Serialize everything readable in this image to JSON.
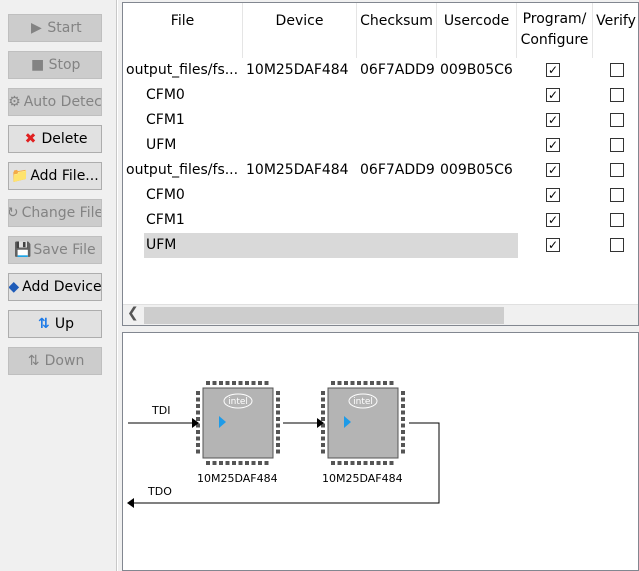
{
  "toolbar": {
    "buttons": [
      {
        "label": "Start",
        "icon": "start-icon",
        "enabled": false
      },
      {
        "label": "Stop",
        "icon": "stop-icon",
        "enabled": false
      },
      {
        "label": "Auto Detec",
        "icon": "auto-detect-icon",
        "enabled": false
      },
      {
        "label": "Delete",
        "icon": "delete-icon",
        "enabled": true
      },
      {
        "label": "Add File...",
        "icon": "add-file-icon",
        "enabled": true
      },
      {
        "label": "Change File",
        "icon": "change-file-icon",
        "enabled": false
      },
      {
        "label": "Save File",
        "icon": "save-file-icon",
        "enabled": false
      },
      {
        "label": "Add Device",
        "icon": "add-device-icon",
        "enabled": true
      },
      {
        "label": "Up",
        "icon": "up-icon",
        "enabled": true
      },
      {
        "label": "Down",
        "icon": "down-icon",
        "enabled": false
      }
    ]
  },
  "table": {
    "headers": [
      "File",
      "Device",
      "Checksum",
      "Usercode",
      "Program/ Configure",
      "Verify"
    ],
    "rows": [
      {
        "file": "output_files/fs...",
        "device": "10M25DAF484",
        "checksum": "06F7ADD9",
        "usercode": "009B05C6",
        "program": true,
        "verify": false
      },
      {
        "file": "CFM0",
        "device": "",
        "checksum": "",
        "usercode": "",
        "program": true,
        "verify": false
      },
      {
        "file": "CFM1",
        "device": "",
        "checksum": "",
        "usercode": "",
        "program": true,
        "verify": false
      },
      {
        "file": "UFM",
        "device": "",
        "checksum": "",
        "usercode": "",
        "program": true,
        "verify": false
      },
      {
        "file": "output_files/fs...",
        "device": "10M25DAF484",
        "checksum": "06F7ADD9",
        "usercode": "009B05C6",
        "program": true,
        "verify": false
      },
      {
        "file": "CFM0",
        "device": "",
        "checksum": "",
        "usercode": "",
        "program": true,
        "verify": false
      },
      {
        "file": "CFM1",
        "device": "",
        "checksum": "",
        "usercode": "",
        "program": true,
        "verify": false
      },
      {
        "file": "UFM",
        "device": "",
        "checksum": "",
        "usercode": "",
        "program": true,
        "verify": false,
        "selected": true
      }
    ]
  },
  "chain": {
    "tdi": "TDI",
    "tdo": "TDO",
    "devices": [
      {
        "name": "10M25DAF484",
        "logo": "intel"
      },
      {
        "name": "10M25DAF484",
        "logo": "intel"
      }
    ]
  },
  "colors": {
    "accent": "#1e9be8",
    "chip": "#b4b4b4"
  }
}
